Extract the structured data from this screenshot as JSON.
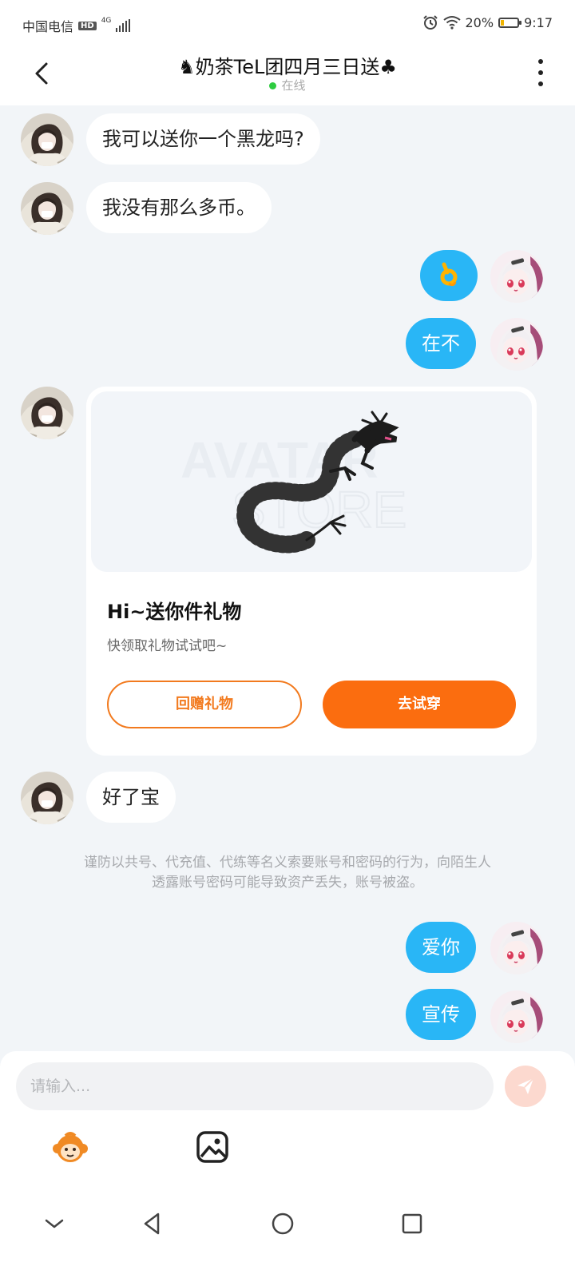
{
  "status_bar": {
    "carrier": "中国电信",
    "hd": "HD",
    "network": "4G",
    "battery_pct": "20%",
    "battery_level": 0.2,
    "time": "9:17"
  },
  "header": {
    "title": "♞奶茶TeL团四月三日送♣",
    "status": "在线",
    "status_color": "#2ecc40"
  },
  "messages": [
    {
      "side": "left",
      "text": "我可以送你一个黑龙吗?"
    },
    {
      "side": "left",
      "text": "我没有那么多币。"
    },
    {
      "side": "right",
      "emoji": "ok-hand-icon"
    },
    {
      "side": "right",
      "text": "在不"
    },
    {
      "side": "left",
      "card": "gift"
    },
    {
      "side": "left",
      "text": "好了宝"
    },
    {
      "side": "system"
    },
    {
      "side": "right",
      "text": "爱你"
    },
    {
      "side": "right",
      "text": "宣传"
    }
  ],
  "gift_card": {
    "title": "Hi~送你件礼物",
    "subtitle": "快领取礼物试试吧~",
    "return_button": "回赠礼物",
    "try_button": "去试穿",
    "watermark_1": "AVATAR",
    "watermark_2": "STORE",
    "accent": "#fb6d0f"
  },
  "warning_text": {
    "line1": "谨防以共号、代充值、代练等名义索要账号和密码的行为，向陌生人",
    "line2": "透露账号密码可能导致资产丢失，账号被盗。"
  },
  "composer": {
    "placeholder": "请输入..."
  },
  "colors": {
    "bubble_mine": "#29b6f6",
    "background": "#f2f5f8"
  }
}
